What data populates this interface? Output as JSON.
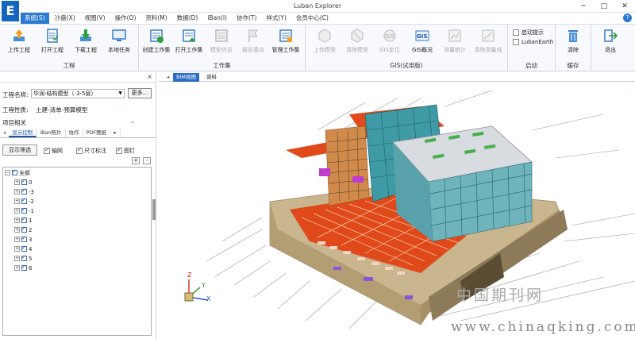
{
  "window": {
    "title": "Luban Explorer",
    "logo_letter": "E"
  },
  "menu": {
    "tabs": [
      "系统(S)",
      "沙盘(X)",
      "视图(V)",
      "操作(O)",
      "资料(M)",
      "数据(D)",
      "iBan(I)",
      "协作(T)",
      "样式(Y)",
      "会员中心(C)"
    ],
    "help": "?"
  },
  "ribbon": {
    "groups": [
      {
        "label": "工程",
        "buttons": [
          "上传工程",
          "打开工程",
          "下载工程",
          "本地任务"
        ]
      },
      {
        "label": "工作集",
        "buttons": [
          "创建工作集",
          "打开工作集",
          "模型信息",
          "报告基点",
          "管理工作集"
        ]
      },
      {
        "label": "GIS(试用版)",
        "buttons": [
          "上传模型",
          "清除模型",
          "GIS定位",
          "GIS概况",
          "测量统计",
          "清除测量线"
        ]
      },
      {
        "label": "启动",
        "checkboxes": [
          "启动提示",
          "LubanEarth"
        ]
      },
      {
        "label": "缓存",
        "buttons": [
          "清除"
        ]
      },
      {
        "label": "",
        "buttons": [
          "退出"
        ]
      }
    ]
  },
  "left_panel": {
    "close": "×",
    "project_name_label": "工程名称:",
    "project_name_value": "华润-结构模型（-3-5层）",
    "more_button": "更多...",
    "project_type_label": "工程性质:",
    "project_type_value": "土建-清单-预算模型",
    "related_label": "项目相关",
    "tabs": [
      "显示控制",
      "iBan照片",
      "协作",
      "PDF图纸",
      "▸"
    ],
    "filter_button": "显示筛选",
    "options": [
      "轴网",
      "尺寸标注",
      "图钉"
    ],
    "plus": "+",
    "minus": "-",
    "tree": {
      "root": "全部",
      "floors": [
        "0",
        "-3",
        "-2",
        "-1",
        "1",
        "2",
        "3",
        "4",
        "5",
        "6"
      ]
    }
  },
  "main": {
    "tabs": [
      "BIM视图",
      "资料"
    ],
    "axis_labels": {
      "z": "Z",
      "y": "Y",
      "x": "X"
    }
  },
  "watermark": {
    "line1": "中国期刊网",
    "line2": "www.chinaqking.com"
  },
  "colors": {
    "accent": "#2b7bd3",
    "floor_red": "#e04a1a",
    "concrete": "#c9b58e",
    "steel_teal": "#3e9ba6",
    "slab_gray": "#d8dbe0"
  }
}
